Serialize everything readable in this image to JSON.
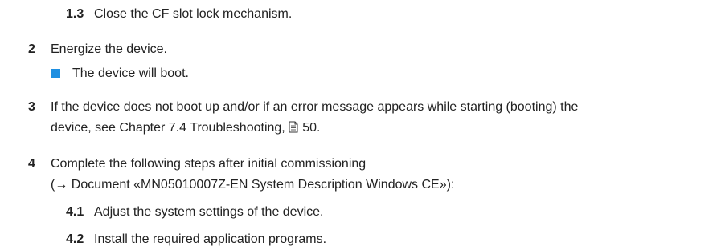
{
  "steps": [
    {
      "number": "1.3",
      "text": "Close the CF slot lock mechanism."
    },
    {
      "number": "2",
      "text": "Energize the device."
    },
    {
      "result": "The device will boot."
    },
    {
      "number": "3",
      "text_line1": "If the device does not boot up and/or if an error message appears while starting (booting) the",
      "text_line2_prefix": "device, see Chapter 7.4 Troubleshooting, ",
      "page_ref": "50."
    },
    {
      "number": "4",
      "text_line1": "Complete the following steps after initial commissioning",
      "text_line2": "(→ Document «MN05010007Z-EN System Description Windows CE»):"
    },
    {
      "number": "4.1",
      "text": "Adjust the system settings of the device."
    },
    {
      "number": "4.2",
      "text": "Install the required application programs."
    }
  ],
  "colors": {
    "text": "#222222",
    "bullet": "#1e8fe1"
  },
  "icons": {
    "result_marker": "blue-square-bullet-icon",
    "page_reference": "document-page-icon"
  }
}
